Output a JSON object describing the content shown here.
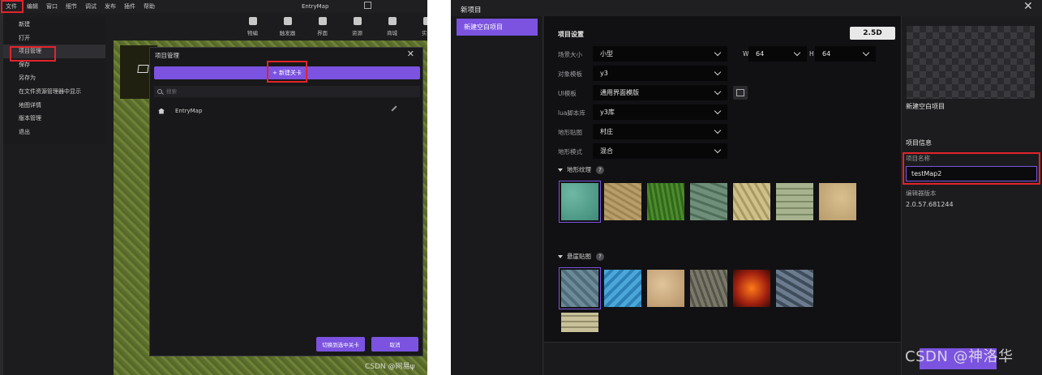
{
  "left": {
    "menu": [
      "文件",
      "编辑",
      "窗口",
      "细节",
      "调试",
      "发布",
      "插件",
      "帮助"
    ],
    "app_title": "EntryMap",
    "toolbar": [
      "物编",
      "触发器",
      "界面",
      "资源",
      "商城",
      "实档"
    ],
    "file_menu": [
      "新建",
      "打开",
      "项目管理",
      "保存",
      "另存为",
      "在文件资源管理器中显示",
      "地图详情",
      "版本管理",
      "退出"
    ],
    "file_menu_selected": "项目管理",
    "project_dialog": {
      "title": "项目管理",
      "new_level": "+ 新建关卡",
      "search_placeholder": "搜索",
      "rows": [
        {
          "name": "EntryMap"
        }
      ],
      "switch_button": "切换到选中关卡",
      "cancel_button": "取消"
    },
    "watermark": "CSDN @网易ψ"
  },
  "right": {
    "title": "新项目",
    "sidebar_item": "新建空白项目",
    "settings_title": "项目设置",
    "mode": "2.5D",
    "fields": [
      {
        "label": "场景大小",
        "value": "小型"
      },
      {
        "label": "对象模板",
        "value": "y3"
      },
      {
        "label": "UI模板",
        "value": "通用界面模版"
      },
      {
        "label": "lua脚本库",
        "value": "y3库"
      },
      {
        "label": "地形贴图",
        "value": "村庄"
      },
      {
        "label": "地形模式",
        "value": "混合"
      }
    ],
    "width": {
      "label": "W",
      "value": "64"
    },
    "height": {
      "label": "H",
      "value": "64"
    },
    "texture_section": "地形纹理",
    "ground_section": "悬崖贴图",
    "help": "?",
    "preview_name": "新建空白项目",
    "info_title": "项目信息",
    "name_label": "项目名称",
    "name_value": "testMap2",
    "version_label": "编辑器版本",
    "version_value": "2.0.57.681244",
    "watermark": "CSDN @神洛华"
  }
}
